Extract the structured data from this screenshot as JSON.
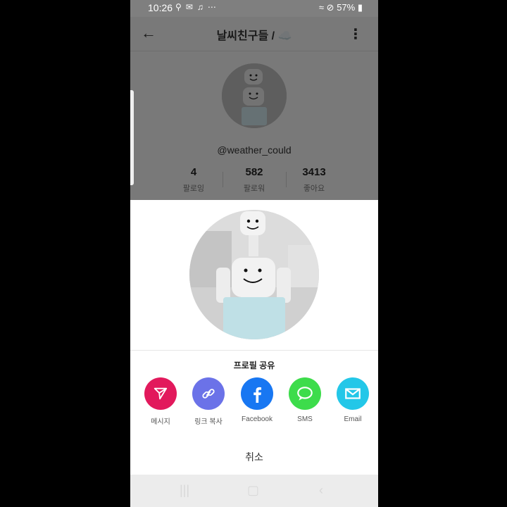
{
  "status_bar": {
    "time": "10:26",
    "battery": "57%"
  },
  "header": {
    "title": "날씨친구들 / ☁️"
  },
  "profile": {
    "username": "@weather_could",
    "stats": [
      {
        "value": "4",
        "label": "팔로잉"
      },
      {
        "value": "582",
        "label": "팔로워"
      },
      {
        "value": "3413",
        "label": "좋아요"
      }
    ]
  },
  "share_sheet": {
    "title": "프로필 공유",
    "options": [
      {
        "label": "메시지",
        "icon": "send-icon",
        "color": "#e2195c"
      },
      {
        "label": "링크 복사",
        "icon": "link-icon",
        "color": "#6b72e8"
      },
      {
        "label": "Facebook",
        "icon": "facebook-icon",
        "color": "#1877f2"
      },
      {
        "label": "SMS",
        "icon": "chat-bubble-icon",
        "color": "#3ddc4b"
      },
      {
        "label": "Email",
        "icon": "envelope-icon",
        "color": "#23c7e8"
      }
    ],
    "cancel": "취소"
  }
}
